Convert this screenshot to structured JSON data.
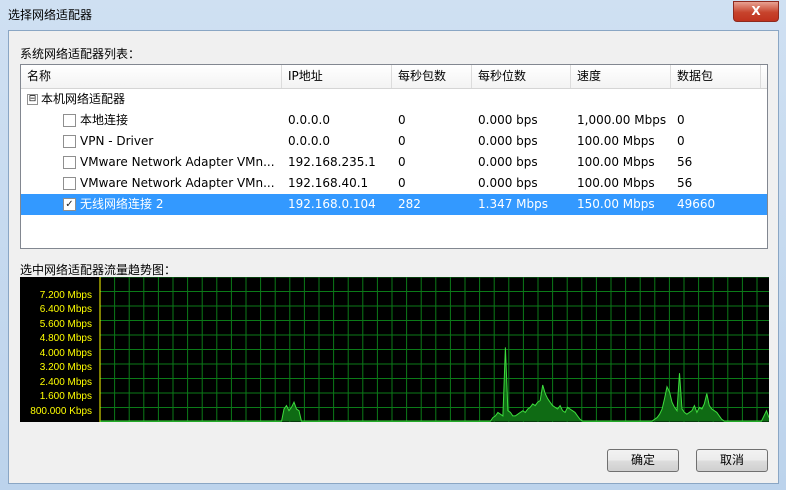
{
  "window": {
    "title": "选择网络适配器",
    "close_glyph": "X"
  },
  "adapter_list": {
    "label": "系统网络适配器列表：",
    "columns": [
      "名称",
      "IP地址",
      "每秒包数",
      "每秒位数",
      "速度",
      "数据包"
    ],
    "group": {
      "toggle": "⊟",
      "label": "本机网络适配器"
    },
    "rows": [
      {
        "checked": false,
        "name": "本地连接",
        "ip": "0.0.0.0",
        "pps": "0",
        "bps": "0.000 bps",
        "speed": "1,000.00 Mbps",
        "packets": "0"
      },
      {
        "checked": false,
        "name": "VPN - Driver",
        "ip": "0.0.0.0",
        "pps": "0",
        "bps": "0.000 bps",
        "speed": "100.00 Mbps",
        "packets": "0"
      },
      {
        "checked": false,
        "name": "VMware Network Adapter VMn...",
        "ip": "192.168.235.1",
        "pps": "0",
        "bps": "0.000 bps",
        "speed": "100.00 Mbps",
        "packets": "56"
      },
      {
        "checked": false,
        "name": "VMware Network Adapter VMn...",
        "ip": "192.168.40.1",
        "pps": "0",
        "bps": "0.000 bps",
        "speed": "100.00 Mbps",
        "packets": "56"
      },
      {
        "checked": true,
        "name": "无线网络连接 2",
        "ip": "192.168.0.104",
        "pps": "282",
        "bps": "1.347 Mbps",
        "speed": "150.00 Mbps",
        "packets": "49660"
      }
    ],
    "scroll": {
      "left": "◀",
      "right": "▶",
      "grip": "|||"
    }
  },
  "traffic": {
    "label": "选中网络适配器流量趋势图：",
    "y_ticks": [
      "7.200 Mbps",
      "6.400 Mbps",
      "5.600 Mbps",
      "4.800 Mbps",
      "4.000 Mbps",
      "3.200 Mbps",
      "2.400 Mbps",
      "1.600 Mbps",
      "800.000 Kbps"
    ],
    "colors": {
      "grid": "#0b7a18",
      "line": "#3ddc3d",
      "fill": "#0f6b14",
      "labels": "#ffff00",
      "background": "#000000"
    },
    "series": {
      "y_max_mbps": 8.0,
      "values_mbps": [
        0,
        0,
        0,
        0,
        0,
        0,
        0,
        0,
        0,
        0,
        0,
        0,
        0,
        0,
        0,
        0,
        0,
        0,
        0,
        0,
        0,
        0,
        0,
        0,
        0,
        0,
        0,
        0,
        0,
        0,
        0,
        0,
        0,
        0,
        0,
        0,
        0,
        0,
        0,
        0,
        0,
        0,
        0,
        0,
        0,
        0,
        0,
        0,
        0,
        0,
        0,
        0,
        0,
        0,
        0,
        0,
        0,
        0,
        0,
        0,
        0,
        0,
        0,
        0,
        0,
        0,
        0,
        0,
        0,
        0,
        0,
        0,
        0,
        0,
        0.7,
        0.9,
        0.6,
        0.8,
        1.1,
        0.7,
        0.6,
        0,
        0,
        0,
        0,
        0,
        0,
        0,
        0,
        0,
        0,
        0,
        0,
        0,
        0,
        0,
        0,
        0,
        0,
        0,
        0,
        0,
        0,
        0,
        0,
        0,
        0,
        0,
        0,
        0,
        0,
        0,
        0,
        0,
        0,
        0,
        0,
        0,
        0,
        0,
        0,
        0,
        0,
        0,
        0,
        0,
        0,
        0,
        0,
        0,
        0,
        0,
        0,
        0,
        0,
        0,
        0,
        0,
        0,
        0,
        0,
        0,
        0,
        0,
        0,
        0,
        0,
        0,
        0,
        0,
        0,
        0,
        0,
        0,
        0,
        0,
        0,
        0,
        0.2,
        0.3,
        0.5,
        0.4,
        0.3,
        4.3,
        0.6,
        0.5,
        0.3,
        0.3,
        0.4,
        0.5,
        0.6,
        0.5,
        0.7,
        0.8,
        1.0,
        0.9,
        1.1,
        1.2,
        2.1,
        1.6,
        1.3,
        1.1,
        0.9,
        0.8,
        0.7,
        0.9,
        0.6,
        0.5,
        0.8,
        0.7,
        0.6,
        0.5,
        0.3,
        0.1,
        0,
        0,
        0,
        0,
        0,
        0,
        0,
        0,
        0,
        0,
        0,
        0,
        0,
        0,
        0,
        0,
        0,
        0,
        0,
        0,
        0,
        0,
        0,
        0,
        0,
        0,
        0,
        0,
        0,
        0.1,
        0.2,
        0.4,
        0.7,
        1.3,
        2.0,
        1.7,
        1.1,
        0.8,
        0.6,
        2.8,
        0.7,
        0.5,
        0.4,
        0.5,
        0.6,
        0.9,
        0.5,
        0.8,
        0.7,
        1.0,
        1.6,
        0.9,
        0.7,
        0.6,
        0.5,
        0.3,
        0.1,
        0,
        0,
        0,
        0,
        0,
        0,
        0,
        0,
        0,
        0,
        0,
        0,
        0,
        0,
        0,
        0,
        0.3,
        0.6,
        0.2
      ]
    }
  },
  "buttons": {
    "ok": "确定",
    "cancel": "取消"
  }
}
